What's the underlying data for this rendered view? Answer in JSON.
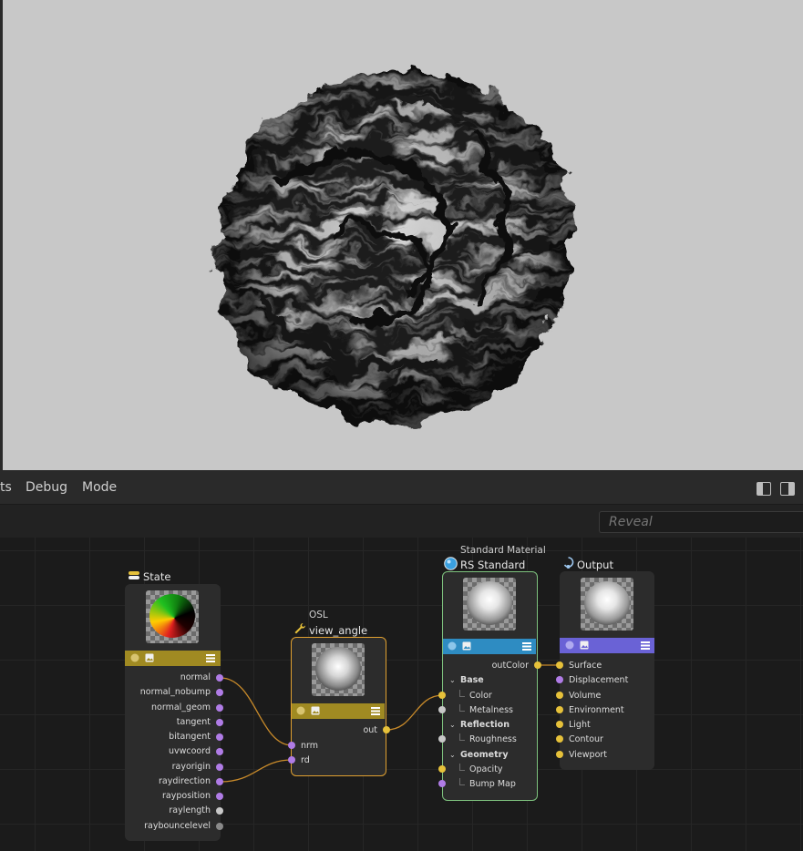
{
  "menubar": {
    "items": [
      "ts",
      "Debug",
      "Mode"
    ]
  },
  "search": {
    "placeholder": "Reveal"
  },
  "nodes": {
    "state": {
      "title": "State",
      "outputs": [
        "normal",
        "normal_nobump",
        "normal_geom",
        "tangent",
        "bitangent",
        "uvwcoord",
        "rayorigin",
        "raydirection",
        "rayposition",
        "raylength",
        "raybouncelevel"
      ]
    },
    "osl": {
      "subtitle": "OSL",
      "title": "view_angle",
      "output": "out",
      "inputs": [
        "nrm",
        "rd"
      ]
    },
    "standard": {
      "subtitle": "Standard Material",
      "title": "RS Standard",
      "output": "outColor",
      "groups": [
        {
          "name": "Base",
          "ports": [
            "Color",
            "Metalness"
          ]
        },
        {
          "name": "Reflection",
          "ports": [
            "Roughness"
          ]
        },
        {
          "name": "Geometry",
          "ports": [
            "Opacity",
            "Bump Map"
          ]
        }
      ]
    },
    "output": {
      "title": "Output",
      "inputs": [
        "Surface",
        "Displacement",
        "Volume",
        "Environment",
        "Light",
        "Contour",
        "Viewport"
      ]
    }
  },
  "colors": {
    "state_header": "#a08a22",
    "osl_header": "#a08a22",
    "standard_header": "#2e8cc2",
    "output_header": "#6a62d6",
    "standard_border": "#7ec27e",
    "osl_border": "#e0a030",
    "wire": "#c88a2a"
  },
  "icons": [
    "state-icon",
    "wrench-icon",
    "material-sphere-icon",
    "output-icon",
    "layout-single-icon",
    "layout-split-icon"
  ]
}
